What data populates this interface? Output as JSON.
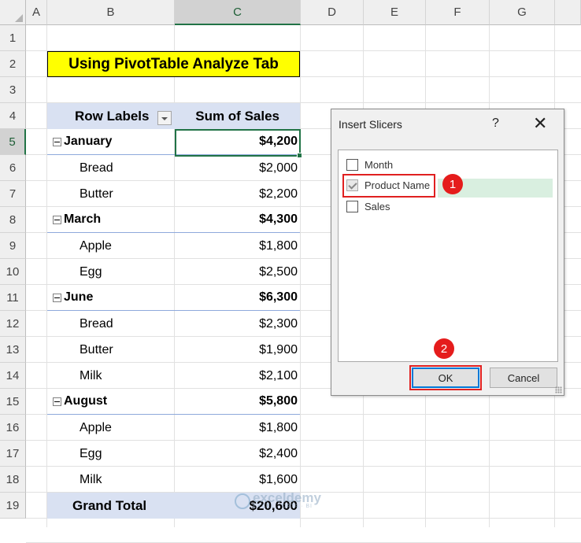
{
  "columns": [
    "A",
    "B",
    "C",
    "D",
    "E",
    "F",
    "G"
  ],
  "rows": [
    "1",
    "2",
    "3",
    "4",
    "5",
    "6",
    "7",
    "8",
    "9",
    "10",
    "11",
    "12",
    "13",
    "14",
    "15",
    "16",
    "17",
    "18",
    "19"
  ],
  "title": "Using PivotTable Analyze Tab",
  "pivot": {
    "header_row_labels": "Row Labels",
    "header_sum": "Sum of Sales",
    "groups": [
      {
        "name": "January",
        "total": "$4,200",
        "items": [
          {
            "name": "Bread",
            "value": "$2,000"
          },
          {
            "name": "Butter",
            "value": "$2,200"
          }
        ]
      },
      {
        "name": "March",
        "total": "$4,300",
        "items": [
          {
            "name": "Apple",
            "value": "$1,800"
          },
          {
            "name": "Egg",
            "value": "$2,500"
          }
        ]
      },
      {
        "name": "June",
        "total": "$6,300",
        "items": [
          {
            "name": "Bread",
            "value": "$2,300"
          },
          {
            "name": "Butter",
            "value": "$1,900"
          },
          {
            "name": "Milk",
            "value": "$2,100"
          }
        ]
      },
      {
        "name": "August",
        "total": "$5,800",
        "items": [
          {
            "name": "Apple",
            "value": "$1,800"
          },
          {
            "name": "Egg",
            "value": "$2,400"
          },
          {
            "name": "Milk",
            "value": "$1,600"
          }
        ]
      }
    ],
    "grand_total_label": "Grand Total",
    "grand_total_value": "$20,600"
  },
  "dialog": {
    "title": "Insert Slicers",
    "help": "?",
    "close": "✕",
    "fields": [
      {
        "label": "Month",
        "checked": false
      },
      {
        "label": "Product Name",
        "checked": true
      },
      {
        "label": "Sales",
        "checked": false
      }
    ],
    "ok_label": "OK",
    "cancel_label": "Cancel",
    "step1": "1",
    "step2": "2"
  },
  "watermark": {
    "name": "exceldemy",
    "sub": "EXCEL · DATA · BI"
  },
  "selected_column": "C",
  "selected_row": "5"
}
